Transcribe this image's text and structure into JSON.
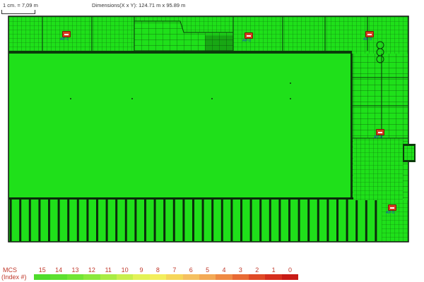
{
  "header": {
    "scale_text": "1 cm. = 7,09 m",
    "dimensions_text": "Dimensions(X x Y): 124.71 m x 95.89 m"
  },
  "access_points": [
    {
      "id": "ap-1",
      "label": "AP-1"
    },
    {
      "id": "ap-2",
      "label": "AP-2"
    },
    {
      "id": "ap-3",
      "label": "AP-3"
    },
    {
      "id": "ap-4",
      "label": "AP-4"
    },
    {
      "id": "ap-5",
      "label": "AP-5"
    }
  ],
  "legend": {
    "title": "MCS",
    "subtitle": "(Index #)",
    "entries": [
      {
        "label": "15",
        "color": "#4fdc2c"
      },
      {
        "label": "14",
        "color": "#5ee030"
      },
      {
        "label": "13",
        "color": "#72e535"
      },
      {
        "label": "12",
        "color": "#8be83c"
      },
      {
        "label": "11",
        "color": "#a9ec44"
      },
      {
        "label": "10",
        "color": "#c8ef4d"
      },
      {
        "label": "9",
        "color": "#e3f257"
      },
      {
        "label": "8",
        "color": "#f3ee5c"
      },
      {
        "label": "7",
        "color": "#f6d65a"
      },
      {
        "label": "6",
        "color": "#f5c060"
      },
      {
        "label": "5",
        "color": "#f3a955"
      },
      {
        "label": "4",
        "color": "#ef8a44"
      },
      {
        "label": "3",
        "color": "#e86a34"
      },
      {
        "label": "2",
        "color": "#e04a26"
      },
      {
        "label": "1",
        "color": "#d62f1e"
      },
      {
        "label": "0",
        "color": "#c81b16"
      }
    ]
  },
  "colors": {
    "coverage_green": "#1fe01a",
    "wall_dark": "#0b3b0b",
    "floor_outline": "#111111"
  }
}
